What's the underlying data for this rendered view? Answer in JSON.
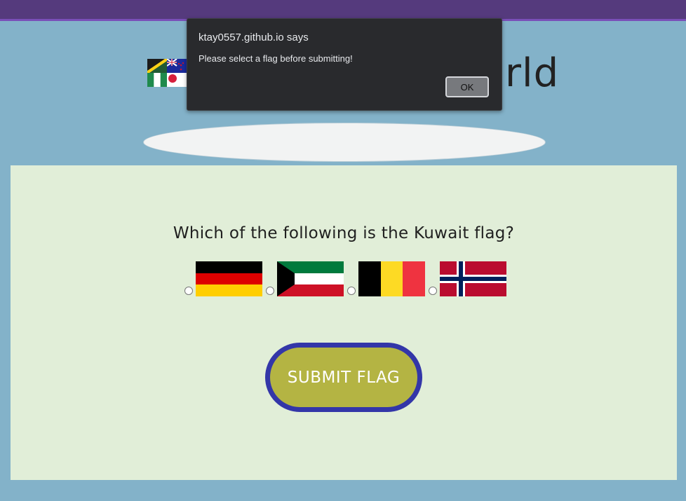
{
  "header": {
    "title_visible_fragment": "rld",
    "colors": {
      "bar": "#553a7d",
      "bar_border": "#7a4fb8",
      "background": "#83b2c9"
    }
  },
  "logo": {
    "icon": "flag-collage-icon"
  },
  "quiz": {
    "question": "Which of the following is the Kuwait flag?",
    "options": [
      {
        "flag": "germany-flag-icon"
      },
      {
        "flag": "kuwait-flag-icon"
      },
      {
        "flag": "belgium-flag-icon"
      },
      {
        "flag": "norway-flag-icon"
      }
    ],
    "submit_label": "SUBMIT FLAG",
    "colors": {
      "panel": "#e1eed8",
      "submit_fill": "#b4b443",
      "submit_border": "#3336a8"
    }
  },
  "alert_dialog": {
    "origin": "ktay0557.github.io says",
    "message": "Please select a flag before submitting!",
    "ok_label": "OK"
  }
}
